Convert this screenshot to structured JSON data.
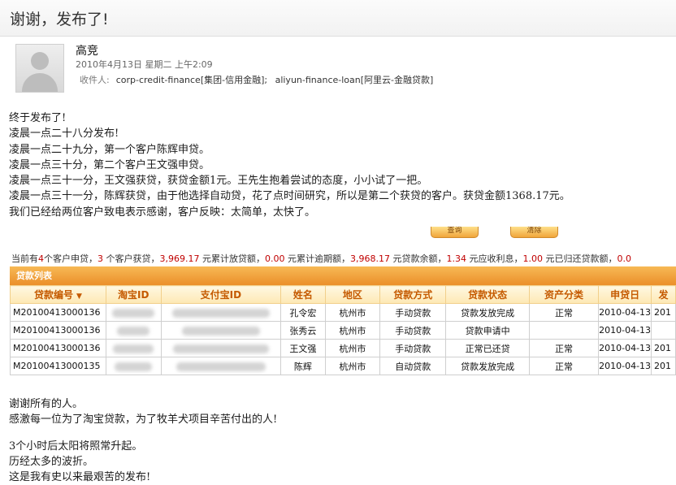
{
  "email": {
    "subject": "谢谢，发布了!",
    "sender": "高竞",
    "sent_time": "2010年4月13日 星期二 上午2:09",
    "recipients_label": "收件人:",
    "recipients": [
      "corp-credit-finance[集团-信用金融];",
      "aliyun-finance-loan[阿里云-金融贷款]"
    ],
    "body_lines": [
      "终于发布了!",
      "凌晨一点二十八分发布!",
      "凌晨一点二十九分，第一个客户陈辉申贷。",
      "凌晨一点三十分，第二个客户王文强申贷。",
      "凌晨一点三十一分，王文强获贷，获贷金额1元。王先生抱着尝试的态度，小小试了一把。",
      "凌晨一点三十一分，陈辉获贷，由于他选择自动贷，花了点时间研究，所以是第二个获贷的客户。获贷金额1368.17元。",
      "我们已经给两位客户致电表示感谢，客户反映：太简单，太快了。"
    ],
    "footer_lines": [
      "谢谢所有的人。",
      "感激每一位为了淘宝贷款，为了牧羊犬项目辛苦付出的人!",
      "",
      "3个小时后太阳将照常升起。",
      "历经太多的波折。",
      "这是我有史以来最艰苦的发布!"
    ]
  },
  "screenshot": {
    "query_button": "查询",
    "clear_button": "清除",
    "stats": [
      {
        "t": "当前有"
      },
      {
        "t": "4",
        "n": true
      },
      {
        "t": "个客户申贷，"
      },
      {
        "t": "3",
        "n": true
      },
      {
        "t": " 个客户获贷，"
      },
      {
        "t": "3,969.17",
        "n": true
      },
      {
        "t": " 元累计放贷额，"
      },
      {
        "t": "0.00",
        "n": true
      },
      {
        "t": " 元累计逾期额，"
      },
      {
        "t": "3,968.17",
        "n": true
      },
      {
        "t": " 元贷款余额，"
      },
      {
        "t": "1.34",
        "n": true
      },
      {
        "t": " 元应收利息，"
      },
      {
        "t": "1.00",
        "n": true
      },
      {
        "t": " 元已归还贷款额，"
      },
      {
        "t": "0.0",
        "n": true
      }
    ],
    "panel_title": "贷款列表",
    "columns": [
      "贷款编号",
      "淘宝ID",
      "支付宝ID",
      "姓名",
      "地区",
      "贷款方式",
      "贷款状态",
      "资产分类",
      "申贷日",
      "发"
    ],
    "rows": [
      {
        "loan_id": "M20100413000136",
        "name": "孔令宏",
        "region": "杭州市",
        "method": "手动贷款",
        "status": "贷款发放完成",
        "asset": "正常",
        "date": "2010-04-13",
        "extra": "201"
      },
      {
        "loan_id": "M20100413000136",
        "name": "张秀云",
        "region": "杭州市",
        "method": "手动贷款",
        "status": "贷款申请中",
        "asset": "",
        "date": "2010-04-13",
        "extra": ""
      },
      {
        "loan_id": "M20100413000136",
        "name": "王文强",
        "region": "杭州市",
        "method": "手动贷款",
        "status": "正常已还贷",
        "asset": "正常",
        "date": "2010-04-13",
        "extra": "201"
      },
      {
        "loan_id": "M20100413000135",
        "name": "陈辉",
        "region": "杭州市",
        "method": "自动贷款",
        "status": "贷款发放完成",
        "asset": "正常",
        "date": "2010-04-13",
        "extra": "201"
      }
    ]
  }
}
